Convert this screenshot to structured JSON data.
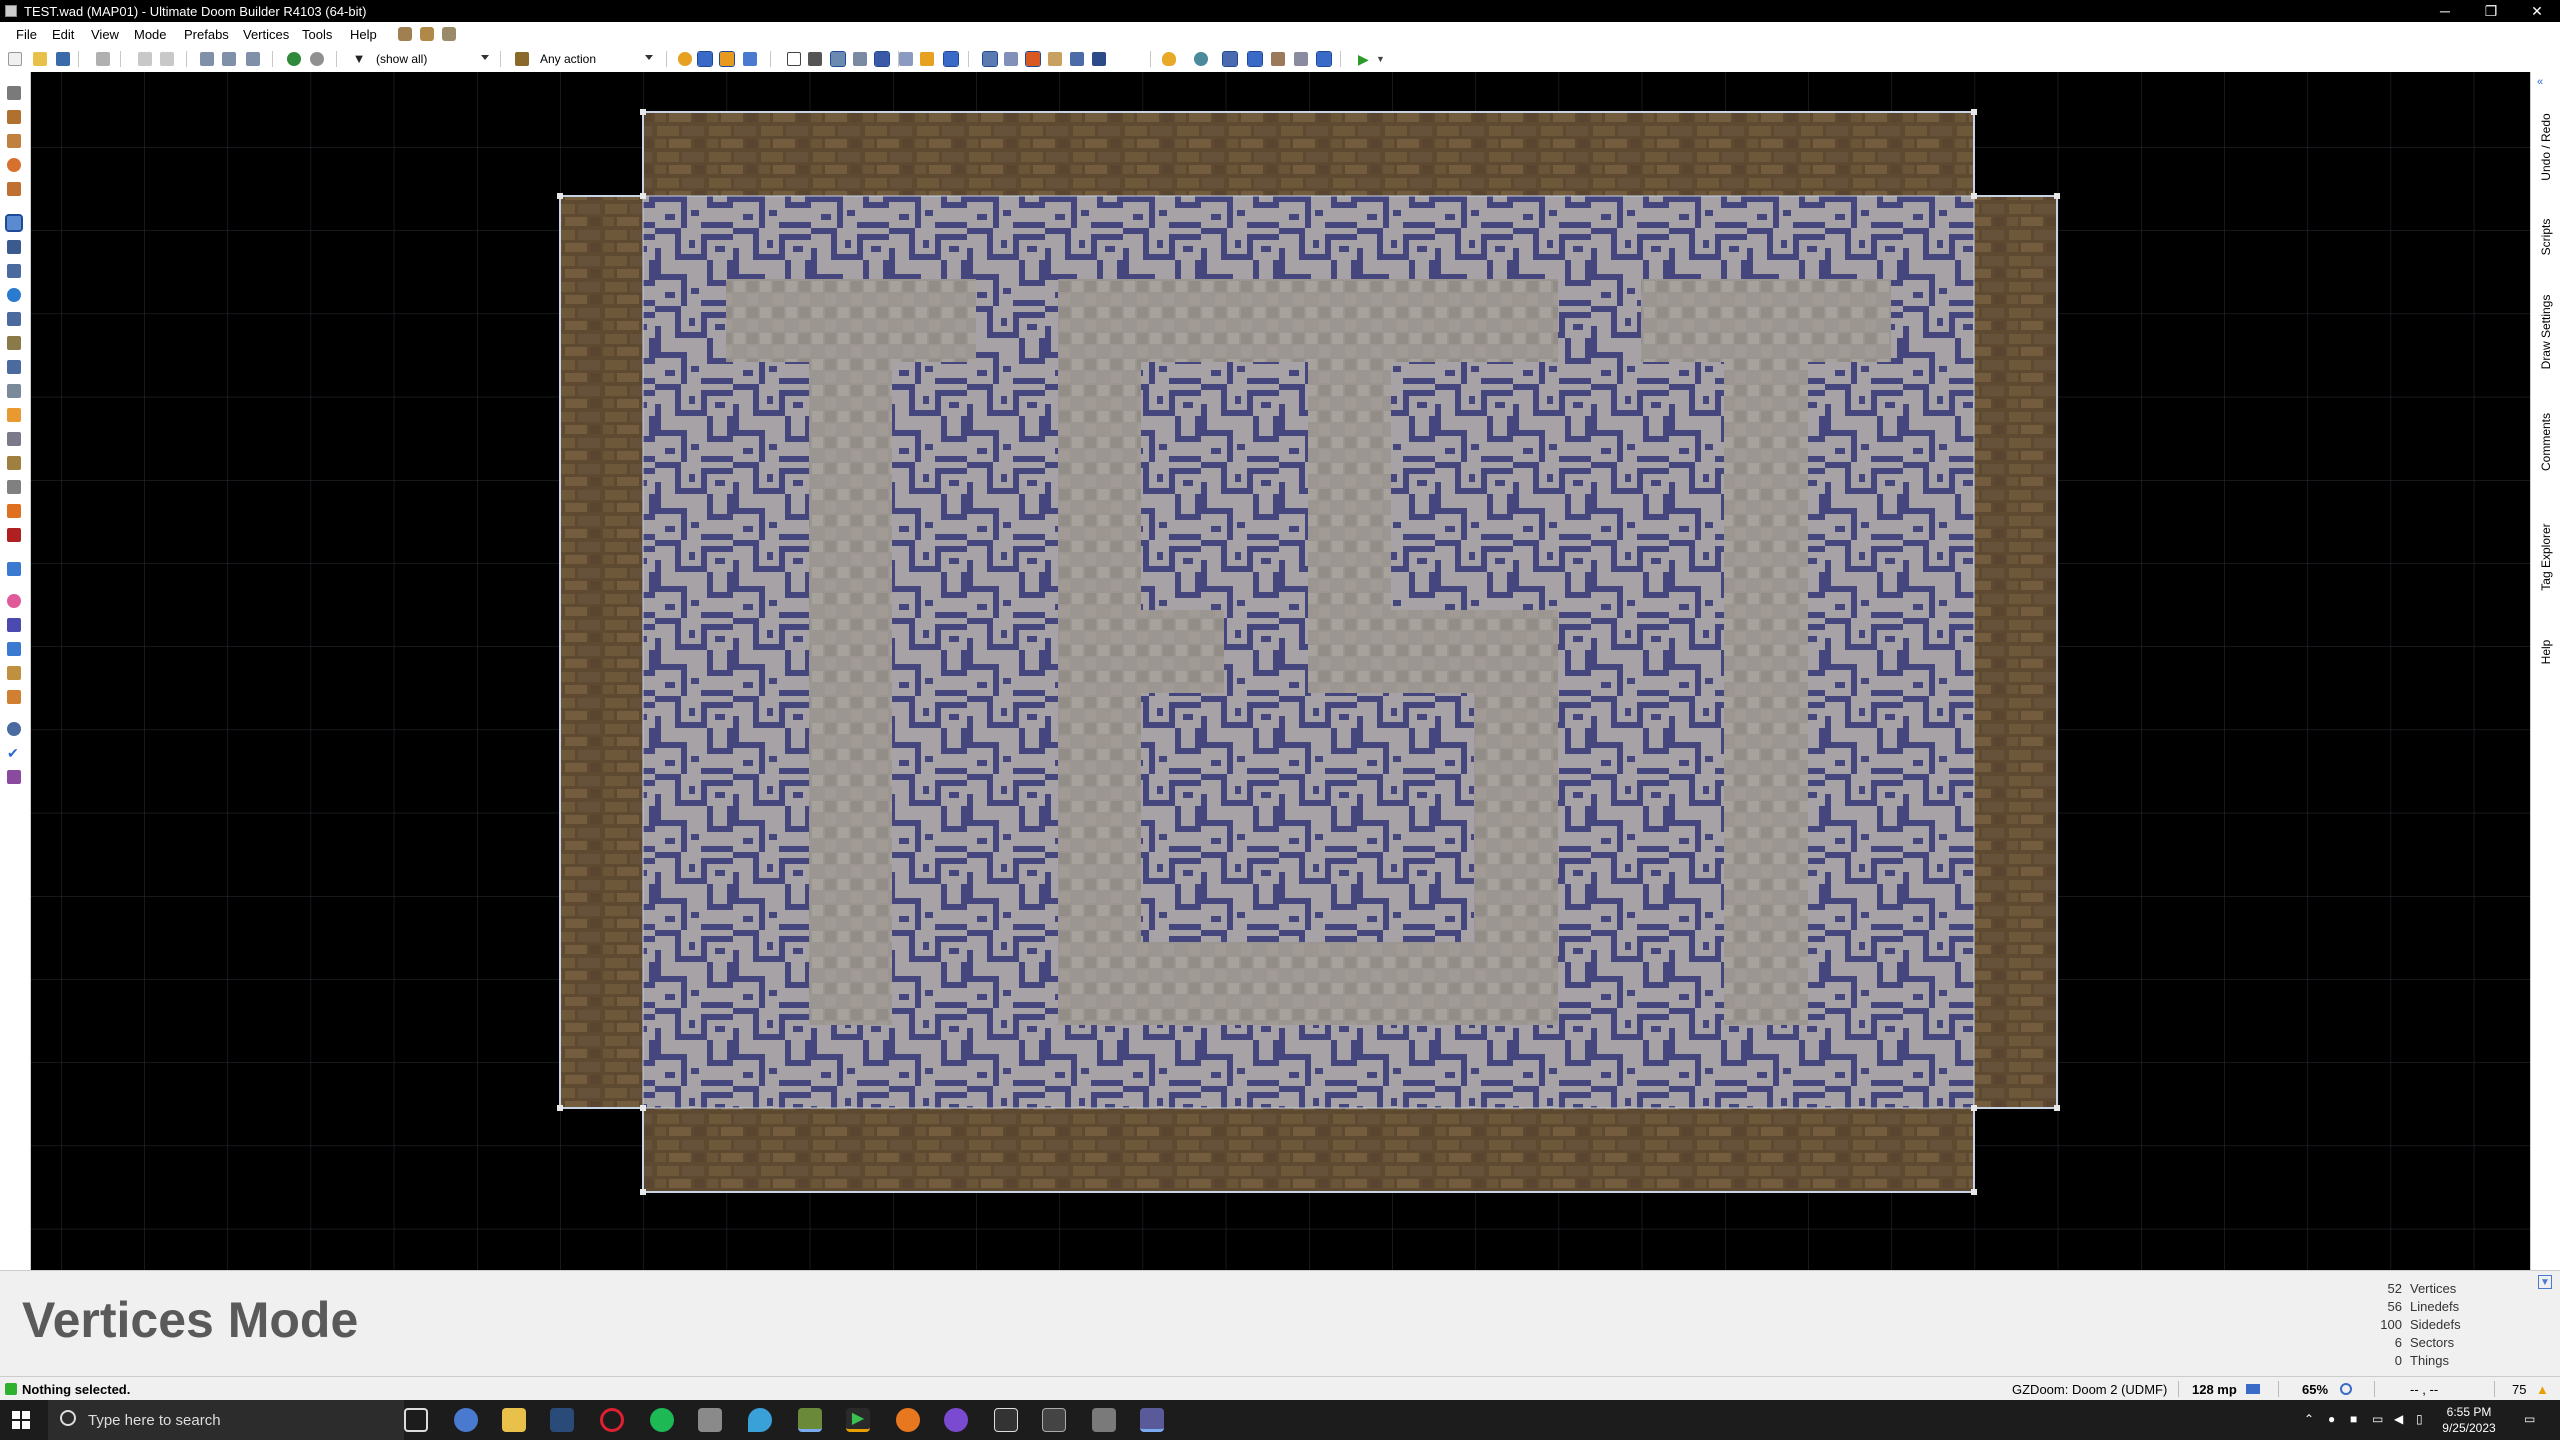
{
  "window": {
    "title": "TEST.wad (MAP01) - Ultimate Doom Builder R4103 (64-bit)",
    "minimize": "─",
    "restore": "❐",
    "close": "✕"
  },
  "menu": [
    "File",
    "Edit",
    "View",
    "Mode",
    "Prefabs",
    "Vertices",
    "Tools",
    "Help"
  ],
  "toolbar": {
    "filter_value": "(show all)",
    "action_value": "Any action"
  },
  "right_tabs": [
    "Undo / Redo",
    "Scripts",
    "Draw Settings",
    "Comments",
    "Tag Explorer",
    "Help"
  ],
  "info": {
    "mode_title": "Vertices Mode",
    "stats": [
      {
        "count": "52",
        "label": "Vertices"
      },
      {
        "count": "56",
        "label": "Linedefs"
      },
      {
        "count": "100",
        "label": "Sidedefs"
      },
      {
        "count": "6",
        "label": "Sectors"
      },
      {
        "count": "0",
        "label": "Things"
      }
    ]
  },
  "status": {
    "message": "Nothing selected.",
    "game_config": "GZDoom: Doom 2 (UDMF)",
    "grid": "128 mp",
    "zoom": "65%",
    "coords": "-- , --",
    "number": "75"
  },
  "taskbar": {
    "search_placeholder": "Type here to search",
    "time": "6:55 PM",
    "date": "9/25/2023"
  },
  "colors": {
    "accent": "#0a64a4",
    "map_line": "#c8d4e4",
    "brown": "#6e5a3a",
    "blue": "#4a4a82",
    "grey": "#9a9494"
  }
}
